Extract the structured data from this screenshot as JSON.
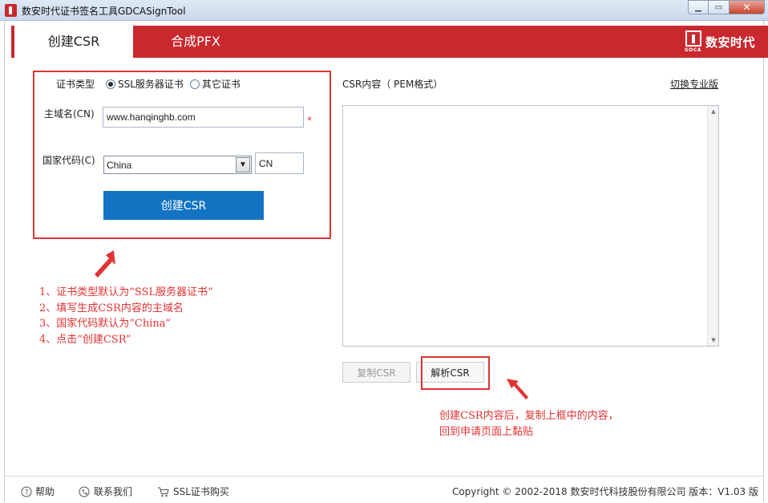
{
  "window": {
    "title": "数安时代证书签名工具GDCASignTool",
    "min_glyph": "▁",
    "max_glyph": "▭",
    "close_glyph": "✕"
  },
  "tabs": [
    {
      "label": "创建CSR",
      "active": true
    },
    {
      "label": "合成PFX",
      "active": false
    }
  ],
  "logo": {
    "name": "数安时代",
    "sub": "GDCA"
  },
  "form": {
    "cert_type_label": "证书类型",
    "cert_type_options": [
      "SSL服务器证书",
      "其它证书"
    ],
    "cert_type_selected": "SSL服务器证书",
    "cn_label": "主域名(CN)",
    "cn_value": "www.hanqinghb.com",
    "required_mark": "*",
    "country_label": "国家代码(C)",
    "country_selected": "China",
    "country_code": "CN",
    "create_button": "创建CSR"
  },
  "annotation_left": {
    "lines": [
      "1、证书类型默认为“SSL服务器证书”",
      "2、填写生成CSR内容的主域名",
      "3、国家代码默认为“China”",
      "4、点击“创建CSR”"
    ]
  },
  "right": {
    "csr_label": "CSR内容（ PEM格式）",
    "switch_link": "切换专业版",
    "copy_button": "复制CSR",
    "parse_button": "解析CSR"
  },
  "annotation_right": {
    "lines": [
      "创建CSR内容后，复制上框中的内容，",
      "回到申请页面上黏贴"
    ]
  },
  "footer": {
    "help": "帮助",
    "contact": "联系我们",
    "buy": "SSL证书购买",
    "copyright": "Copyright © 2002-2018 数安时代科技股份有限公司 版本：V1.03 版"
  },
  "colors": {
    "brand_red": "#c9282e",
    "primary_blue": "#1273c2",
    "annotation_red": "#e23333"
  }
}
